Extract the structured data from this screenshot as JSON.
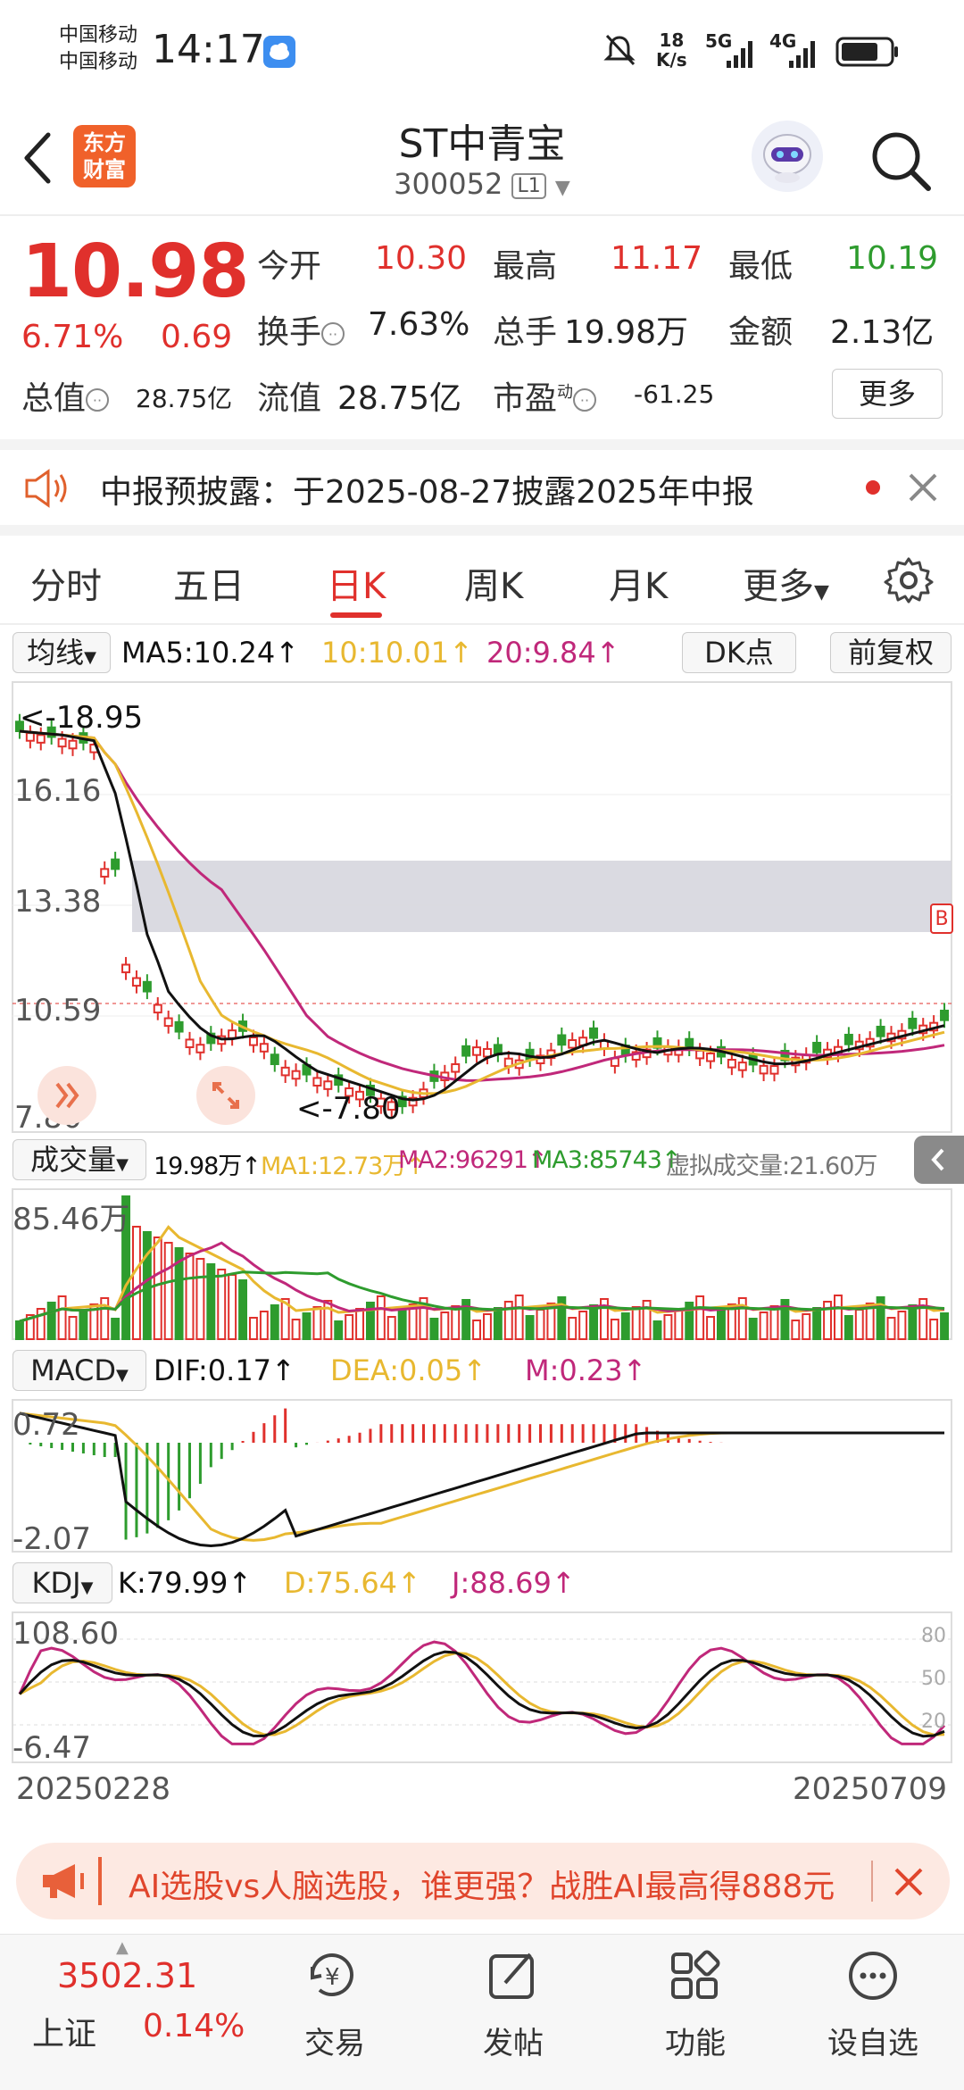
{
  "status": {
    "carrier1": "中国移动",
    "carrier2": "中国移动",
    "time": "14:17",
    "net_speed_top": "18",
    "net_speed_unit": "K/s",
    "signal1": "5G",
    "signal2": "4G"
  },
  "header": {
    "logo_line1": "东方",
    "logo_line2": "财富",
    "stock_name": "ST中青宝",
    "stock_code": "300052",
    "level": "L1"
  },
  "quote": {
    "price": "10.98",
    "change_pct": "6.71%",
    "change_abs": "0.69",
    "open_label": "今开",
    "open": "10.30",
    "high_label": "最高",
    "high": "11.17",
    "low_label": "最低",
    "low": "10.19",
    "turnover_label": "换手",
    "turnover": "7.63%",
    "volume_label": "总手",
    "volume": "19.98万",
    "amount_label": "金额",
    "amount": "2.13亿",
    "mktcap_label": "总值",
    "mktcap": "28.75亿",
    "float_label": "流值",
    "float": "28.75亿",
    "pe_label": "市盈",
    "pe_sup": "动",
    "pe": "-61.25",
    "more": "更多"
  },
  "notice": {
    "text": "中报预披露：于2025-08-27披露2025年中报"
  },
  "tabs": [
    "分时",
    "五日",
    "日K",
    "周K",
    "月K",
    "更多"
  ],
  "active_tab": 2,
  "ma_bar": {
    "selector": "均线",
    "ma5": "MA5:10.24",
    "ma10": "10:10.01",
    "ma20": "20:9.84",
    "dk": "DK点",
    "fq": "前复权"
  },
  "kline": {
    "y_labels": [
      "16.16",
      "13.38",
      "10.59",
      "7.80"
    ],
    "y_top_label": "18.95",
    "high_marker": "<-18.95",
    "low_marker": "<-7.80"
  },
  "volume_bar": {
    "selector": "成交量",
    "vol": "19.98万",
    "ma1": "MA1:12.73万",
    "ma2": "MA2:96291",
    "ma3": "MA3:85743",
    "virtual": "虚拟成交量:21.60万",
    "max_label": "85.46万"
  },
  "macd_bar": {
    "selector": "MACD",
    "dif": "DIF:0.17",
    "dea": "DEA:0.05",
    "m": "M:0.23",
    "top": "0.72",
    "bottom": "-2.07"
  },
  "kdj_bar": {
    "selector": "KDJ",
    "k": "K:79.99",
    "d": "D:75.64",
    "j": "J:88.69",
    "top": "108.60",
    "bottom": "-6.47",
    "levels": [
      "80",
      "50",
      "20"
    ]
  },
  "dates": {
    "start": "20250228",
    "end": "20250709"
  },
  "ad": {
    "text": "AI选股vs人脑选股，谁更强？战胜AI最高得888元"
  },
  "bottom": {
    "index_value": "3502.31",
    "index_name": "上证",
    "index_pct": "0.14%",
    "trade": "交易",
    "post": "发帖",
    "func": "功能",
    "watch": "设自选"
  },
  "colors": {
    "up": "#e0302c",
    "down": "#2e9c2e",
    "ma5": "#111111",
    "ma10": "#e8b830",
    "ma20": "#c0287a",
    "accent": "#e0302c"
  }
}
